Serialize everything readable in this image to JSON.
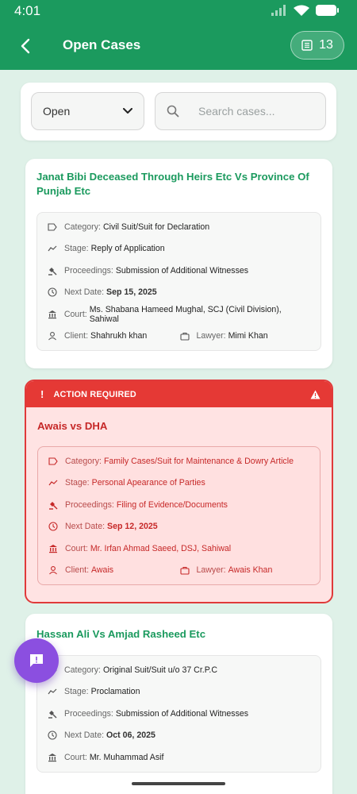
{
  "status_bar": {
    "time": "4:01"
  },
  "appbar": {
    "title": "Open Cases",
    "count": "13"
  },
  "filter": {
    "status_value": "Open",
    "search_placeholder": "Search cases..."
  },
  "cases": [
    {
      "title": "Janat Bibi Deceased Through Heirs Etc Vs Province Of Punjab Etc",
      "category_label": "Category:",
      "category": "Civil Suit/Suit for Declaration",
      "stage_label": "Stage:",
      "stage": "Reply of Application",
      "proceedings_label": "Proceedings:",
      "proceedings": "Submission of Additional Witnesses",
      "next_date_label": "Next Date:",
      "next_date": "Sep 15, 2025",
      "court_label": "Court:",
      "court": "Ms. Shabana Hameed Mughal, SCJ (Civil Division), Sahiwal",
      "client_label": "Client:",
      "client": "Shahrukh khan",
      "lawyer_label": "Lawyer:",
      "lawyer": "Mimi Khan"
    },
    {
      "banner": "ACTION REQUIRED",
      "title": "Awais vs DHA",
      "category_label": "Category:",
      "category": "Family Cases/Suit for Maintenance & Dowry Article",
      "stage_label": "Stage:",
      "stage": "Personal Apearance of Parties",
      "proceedings_label": "Proceedings:",
      "proceedings": "Filing of Evidence/Documents",
      "next_date_label": "Next Date:",
      "next_date": "Sep 12, 2025",
      "court_label": "Court:",
      "court": "Mr. Irfan Ahmad Saeed, DSJ, Sahiwal",
      "client_label": "Client:",
      "client": "Awais",
      "lawyer_label": "Lawyer:",
      "lawyer": "Awais Khan"
    },
    {
      "title": "Hassan Ali Vs Amjad Rasheed Etc",
      "category_label": "Category:",
      "category": "Original Suit/Suit u/o 37 Cr.P.C",
      "stage_label": "Stage:",
      "stage": "Proclamation",
      "proceedings_label": "Proceedings:",
      "proceedings": "Submission of Additional Witnesses",
      "next_date_label": "Next Date:",
      "next_date": "Oct 06, 2025",
      "court_label": "Court:",
      "court": "Mr. Muhammad Asif"
    }
  ],
  "colors": {
    "primary": "#1b9a5e",
    "alert": "#e53935",
    "fab": "#8b4fe0"
  }
}
